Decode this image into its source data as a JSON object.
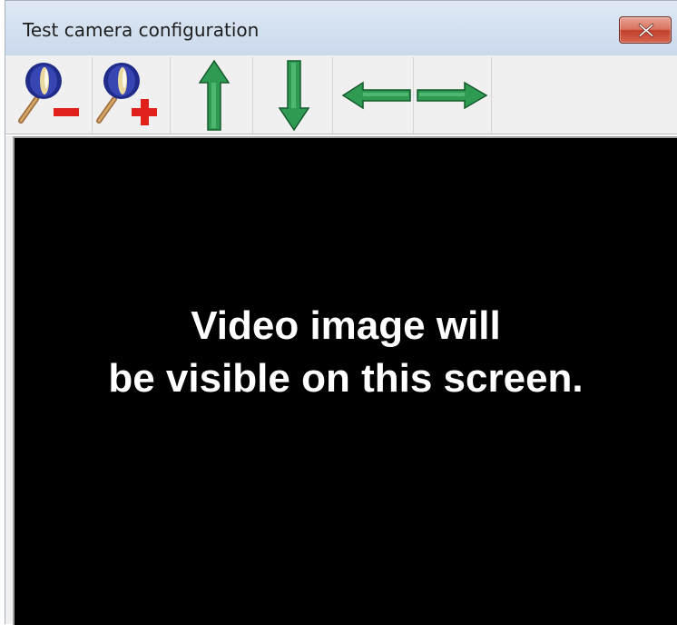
{
  "window": {
    "title": "Test camera configuration"
  },
  "title_bar_buttons": [
    {
      "icon": "close-icon"
    }
  ],
  "toolbar": {
    "buttons": [
      {
        "icon": "zoom-out-icon"
      },
      {
        "icon": "zoom-in-icon"
      },
      {
        "icon": "arrow-up-icon"
      },
      {
        "icon": "arrow-down-icon"
      },
      {
        "icon": "arrow-left-icon"
      },
      {
        "icon": "arrow-right-icon"
      }
    ]
  },
  "video": {
    "message_line1": "Video image will",
    "message_line2": "be visible on this screen.",
    "background_color": "#000000",
    "text_color": "#ffffff"
  },
  "colors": {
    "arrow_green": "#2e9a52",
    "minus_plus_red": "#e0201b",
    "close_red": "#c94a33",
    "titlebar": "#d6e3f2"
  }
}
